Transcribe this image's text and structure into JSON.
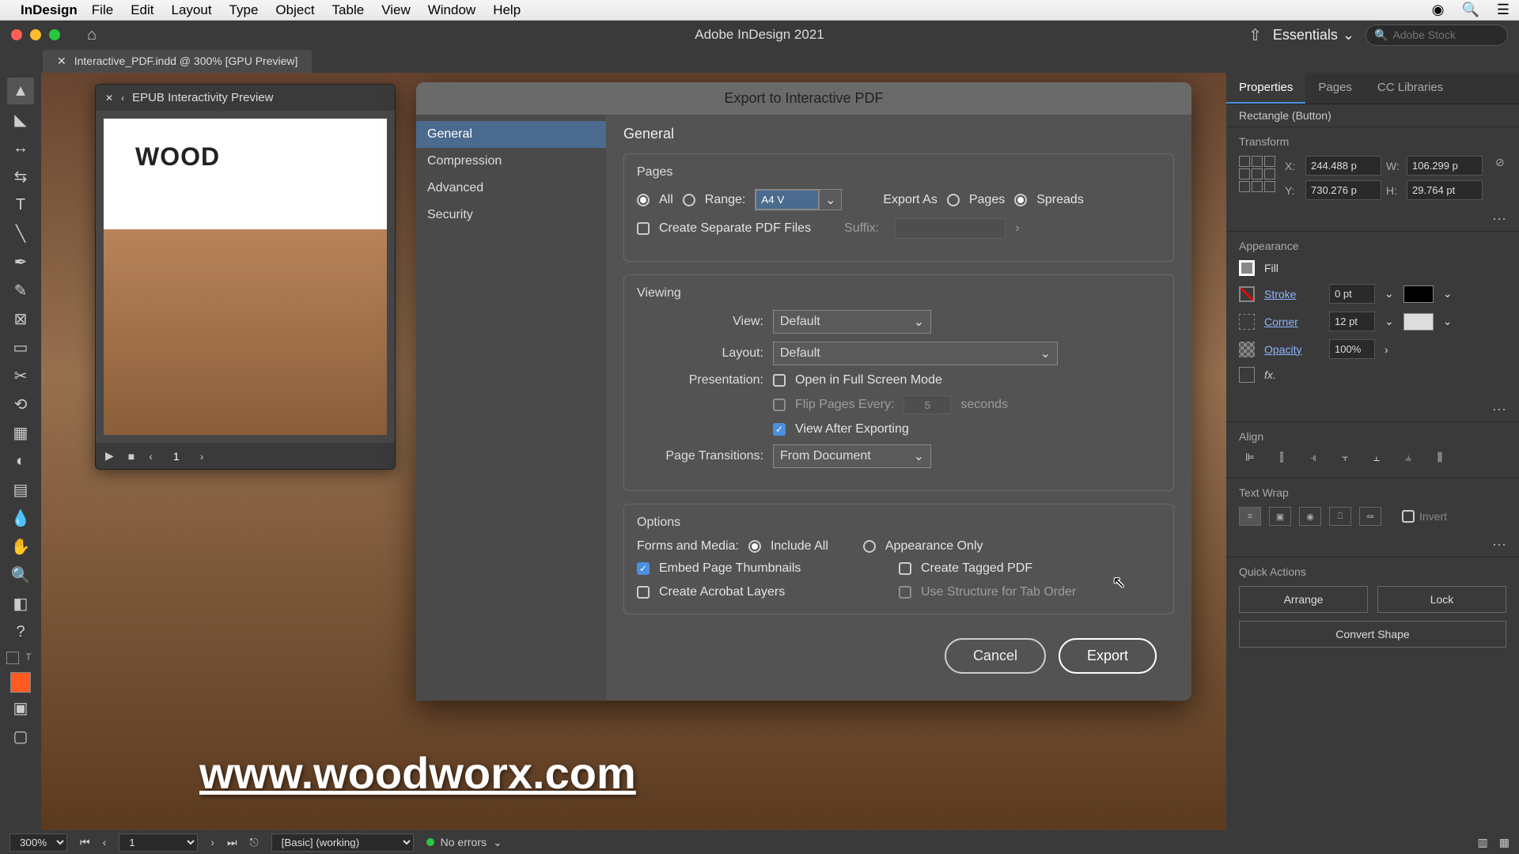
{
  "menubar": {
    "app_name": "InDesign",
    "items": [
      "File",
      "Edit",
      "Layout",
      "Type",
      "Object",
      "Table",
      "View",
      "Window",
      "Help"
    ]
  },
  "titlebar": {
    "title": "Adobe InDesign 2021",
    "workspace": "Essentials",
    "stock_placeholder": "Adobe Stock"
  },
  "tab": {
    "label": "Interactive_PDF.indd @ 300% [GPU Preview]"
  },
  "epub_panel": {
    "title": "EPUB Interactivity Preview",
    "logo_text": "WOOD",
    "page": "1"
  },
  "canvas": {
    "url_text": "www.woodworx.com"
  },
  "right_panel": {
    "tabs": [
      "Properties",
      "Pages",
      "CC Libraries"
    ],
    "selection": "Rectangle (Button)",
    "transform": {
      "header": "Transform",
      "x": "244.488 p",
      "y": "730.276 p",
      "w": "106.299 p",
      "h": "29.764 pt"
    },
    "appearance": {
      "header": "Appearance",
      "fill": "Fill",
      "stroke": "Stroke",
      "corner": "Corner",
      "opacity": "Opacity",
      "stroke_val": "0 pt",
      "corner_val": "12 pt",
      "opacity_val": "100%"
    },
    "align": "Align",
    "text_wrap": "Text Wrap",
    "invert": "Invert",
    "quick_actions": {
      "header": "Quick Actions",
      "arrange": "Arrange",
      "lock": "Lock",
      "convert": "Convert Shape"
    }
  },
  "status": {
    "zoom": "300%",
    "page": "1",
    "preset": "[Basic] (working)",
    "errors": "No errors"
  },
  "dialog": {
    "title": "Export to Interactive PDF",
    "sidebar": [
      "General",
      "Compression",
      "Advanced",
      "Security"
    ],
    "content_heading": "General",
    "pages": {
      "title": "Pages",
      "all": "All",
      "range": "Range:",
      "range_value": "A4 V",
      "export_as": "Export As",
      "pages_opt": "Pages",
      "spreads_opt": "Spreads",
      "create_separate": "Create Separate PDF Files",
      "suffix": "Suffix:"
    },
    "viewing": {
      "title": "Viewing",
      "view": "View:",
      "view_val": "Default",
      "layout": "Layout:",
      "layout_val": "Default",
      "presentation": "Presentation:",
      "open_full": "Open in Full Screen Mode",
      "flip_every": "Flip Pages Every:",
      "flip_val": "5",
      "seconds": "seconds",
      "view_after": "View After Exporting",
      "transitions": "Page Transitions:",
      "transitions_val": "From Document"
    },
    "options": {
      "title": "Options",
      "forms_media": "Forms and Media:",
      "include_all": "Include All",
      "appearance_only": "Appearance Only",
      "embed_thumbs": "Embed Page Thumbnails",
      "create_tagged": "Create Tagged PDF",
      "create_layers": "Create Acrobat Layers",
      "use_structure": "Use Structure for Tab Order"
    },
    "cancel": "Cancel",
    "export": "Export"
  }
}
